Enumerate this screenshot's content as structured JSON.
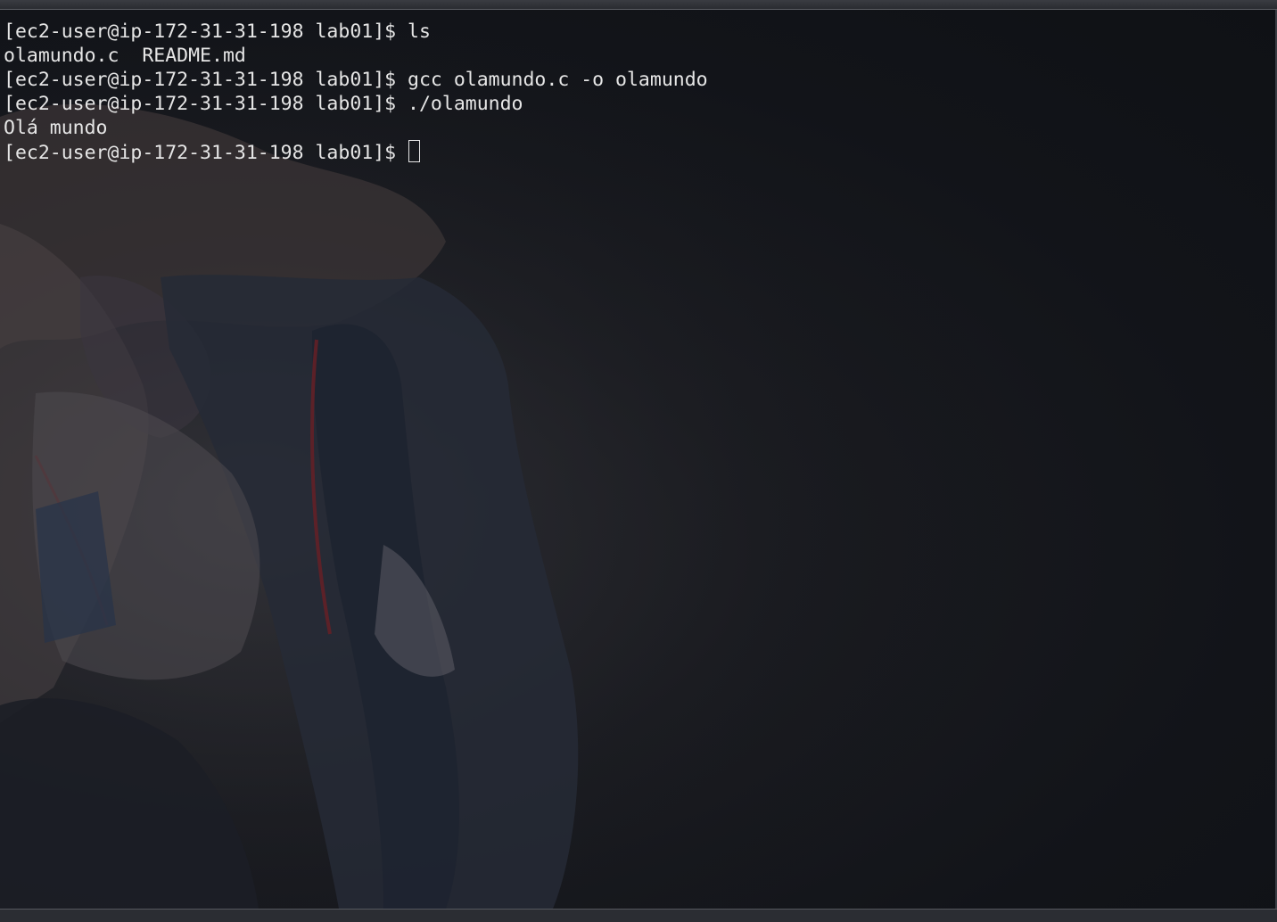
{
  "terminal": {
    "prompt": "[ec2-user@ip-172-31-31-198 lab01]$ ",
    "lines": [
      {
        "type": "command",
        "text": "ls"
      },
      {
        "type": "output",
        "text": "olamundo.c  README.md"
      },
      {
        "type": "command",
        "text": "gcc olamundo.c -o olamundo"
      },
      {
        "type": "command",
        "text": "./olamundo"
      },
      {
        "type": "output",
        "text": "Olá mundo"
      },
      {
        "type": "command",
        "text": ""
      }
    ]
  },
  "colors": {
    "text": "#e6e6e6",
    "background": "#111318"
  },
  "icons": {
    "cursor": "block-cursor-icon"
  }
}
